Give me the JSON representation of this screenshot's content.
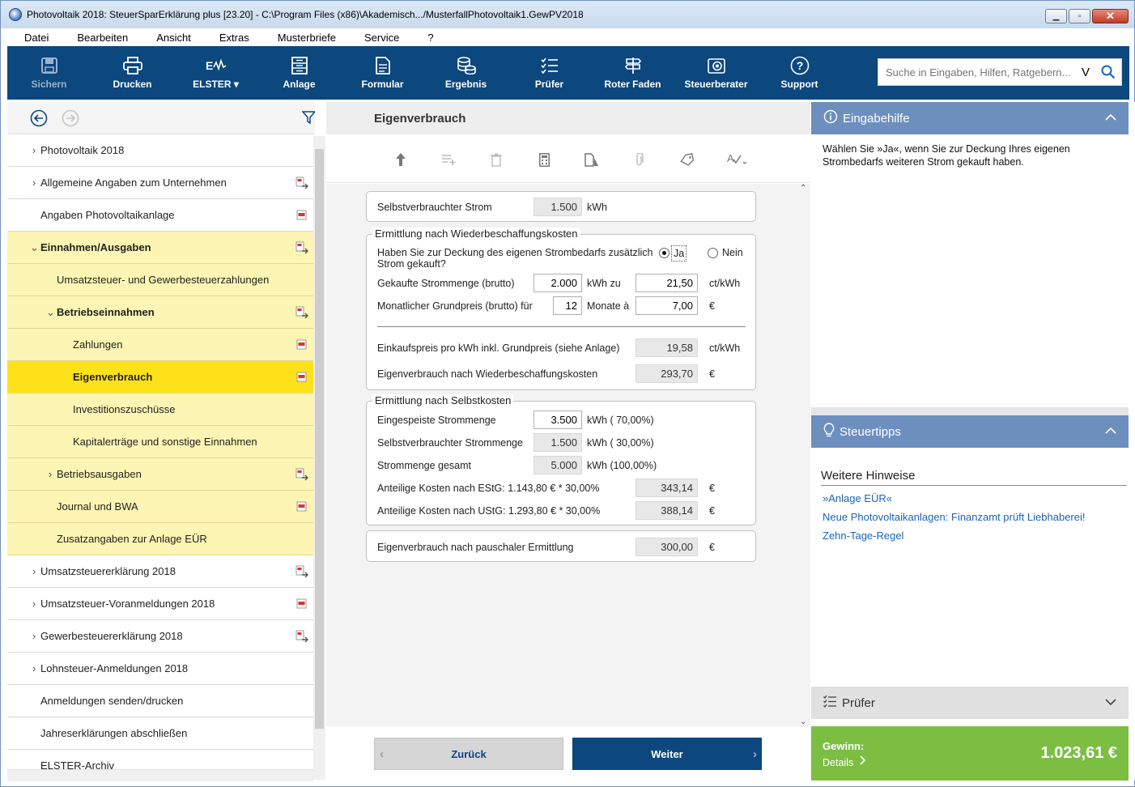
{
  "window": {
    "title": "Photovoltaik 2018: SteuerSparErklärung plus [23.20] - C:\\Program Files (x86)\\Akademisch.../MusterfallPhotovoltaik1.GewPV2018",
    "minimize": "▁",
    "maximize": "▫",
    "close": "✕"
  },
  "menu": [
    "Datei",
    "Bearbeiten",
    "Ansicht",
    "Extras",
    "Musterbriefe",
    "Service",
    "?"
  ],
  "toolbar": [
    {
      "label": "Sichern",
      "icon": "save-icon",
      "enabled": false
    },
    {
      "label": "Drucken",
      "icon": "printer-icon",
      "enabled": true
    },
    {
      "label": "ELSTER ▾",
      "icon": "elster-icon",
      "enabled": true
    },
    {
      "label": "Anlage",
      "icon": "anlage-icon",
      "enabled": true
    },
    {
      "label": "Formular",
      "icon": "form-icon",
      "enabled": true
    },
    {
      "label": "Ergebnis",
      "icon": "coins-icon",
      "enabled": true
    },
    {
      "label": "Prüfer",
      "icon": "checklist-icon",
      "enabled": true
    },
    {
      "label": "Roter Faden",
      "icon": "signpost-icon",
      "enabled": true
    },
    {
      "label": "Steuerberater",
      "icon": "advisor-icon",
      "enabled": true
    },
    {
      "label": "Support",
      "icon": "help-icon",
      "enabled": true
    }
  ],
  "search": {
    "placeholder": "Suche in Eingaben, Hilfen, Ratgebern...",
    "dropdown": "V"
  },
  "nav": {
    "items": [
      {
        "label": "Photovoltaik 2018",
        "chevron": "›",
        "mark": ""
      },
      {
        "label": "Allgemeine Angaben zum Unternehmen",
        "chevron": "›",
        "mark": "arrow"
      },
      {
        "label": "Angaben Photovoltaikanlage",
        "chevron": "",
        "mark": "flag"
      },
      {
        "label": "Einnahmen/Ausgaben",
        "chevron": "⌄",
        "mark": "arrow"
      },
      {
        "label": "Umsatzsteuer- und Gewerbesteuerzahlungen",
        "chevron": "",
        "mark": ""
      },
      {
        "label": "Betriebseinnahmen",
        "chevron": "⌄",
        "mark": "arrow"
      },
      {
        "label": "Zahlungen",
        "chevron": "",
        "mark": "flag"
      },
      {
        "label": "Eigenverbrauch",
        "chevron": "",
        "mark": "flag"
      },
      {
        "label": "Investitionszuschüsse",
        "chevron": "",
        "mark": ""
      },
      {
        "label": "Kapitalerträge und sonstige Einnahmen",
        "chevron": "",
        "mark": ""
      },
      {
        "label": "Betriebsausgaben",
        "chevron": "›",
        "mark": "arrow"
      },
      {
        "label": "Journal und BWA",
        "chevron": "",
        "mark": "flag"
      },
      {
        "label": "Zusatzangaben zur Anlage EÜR",
        "chevron": "",
        "mark": ""
      },
      {
        "label": "Umsatzsteuererklärung 2018",
        "chevron": "›",
        "mark": "arrow"
      },
      {
        "label": "Umsatzsteuer-Voranmeldungen 2018",
        "chevron": "›",
        "mark": "flag"
      },
      {
        "label": "Gewerbesteuererklärung 2018",
        "chevron": "›",
        "mark": "arrow"
      },
      {
        "label": "Lohnsteuer-Anmeldungen 2018",
        "chevron": "›",
        "mark": ""
      },
      {
        "label": "Anmeldungen senden/drucken",
        "chevron": "",
        "mark": ""
      },
      {
        "label": "Jahreserklärungen abschließen",
        "chevron": "",
        "mark": ""
      },
      {
        "label": "ELSTER-Archiv",
        "chevron": "",
        "mark": ""
      }
    ]
  },
  "page": {
    "title": "Eigenverbrauch",
    "selbstverbrauch": {
      "label": "Selbstverbrauchter Strom",
      "value": "1.500",
      "unit": "kWh"
    },
    "wieder": {
      "legend": "Ermittlung nach Wiederbeschaffungskosten",
      "question": "Haben Sie zur Deckung des eigenen Strombedarfs zusätzlich",
      "question2": "Strom gekauft?",
      "ja": "Ja",
      "nein": "Nein",
      "gekauft_label": "Gekaufte Strommenge (brutto)",
      "gekauft_value": "2.000",
      "gekauft_unit": "kWh zu",
      "preis_value": "21,50",
      "preis_unit": "ct/kWh",
      "grund_label": "Monatlicher Grundpreis (brutto) für",
      "monate_value": "12",
      "monate_unit": "Monate à",
      "grund_value": "7,00",
      "grund_unit": "€",
      "einkauf_label": "Einkaufspreis pro kWh inkl. Grundpreis (siehe Anlage)",
      "einkauf_value": "19,58",
      "einkauf_unit": "ct/kWh",
      "ev_label": "Eigenverbrauch nach Wiederbeschaffungskosten",
      "ev_value": "293,70",
      "ev_unit": "€"
    },
    "selbst": {
      "legend": "Ermittlung nach Selbstkosten",
      "einges_label": "Eingespeiste Strommenge",
      "einges_value": "3.500",
      "einges_unit": "kWh ( 70,00%)",
      "selbstv_label": "Selbstverbrauchter Strommenge",
      "selbstv_value": "1.500",
      "selbstv_unit": "kWh ( 30,00%)",
      "gesamt_label": "Strommenge gesamt",
      "gesamt_value": "5.000",
      "gesamt_unit": "kWh (100,00%)",
      "estg_label": "Anteilige Kosten nach EStG: 1.143,80 € * 30,00%",
      "estg_value": "343,14",
      "estg_unit": "€",
      "ustg_label": "Anteilige Kosten nach UStG: 1.293,80 € * 30,00%",
      "ustg_value": "388,14",
      "ustg_unit": "€"
    },
    "pausch": {
      "label": "Eigenverbrauch nach pauschaler Ermittlung",
      "value": "300,00",
      "unit": "€"
    },
    "back": "Zurück",
    "next": "Weiter"
  },
  "help": {
    "title": "Eingabehilfe",
    "text1": "Wählen Sie »Ja«, wenn Sie zur Deckung Ihres eigenen",
    "text2": "Strombedarfs weiteren Strom gekauft haben."
  },
  "tips": {
    "title": "Steuertipps",
    "heading": "Weitere Hinweise",
    "links": [
      "»Anlage EÜR«",
      "Neue Photovoltaikanlagen: Finanzamt prüft Liebhaberei!",
      "Zehn-Tage-Regel"
    ]
  },
  "pruefer": {
    "title": "Prüfer"
  },
  "gewinn": {
    "label": "Gewinn:",
    "details": "Details",
    "value": "1.023,61 €"
  },
  "colors": {
    "toolbar": "#0c477e",
    "highlight": "#ffe11a",
    "section": "#fdf5b3",
    "panelhead": "#6d8fbe",
    "gewinn": "#7cbe42"
  }
}
